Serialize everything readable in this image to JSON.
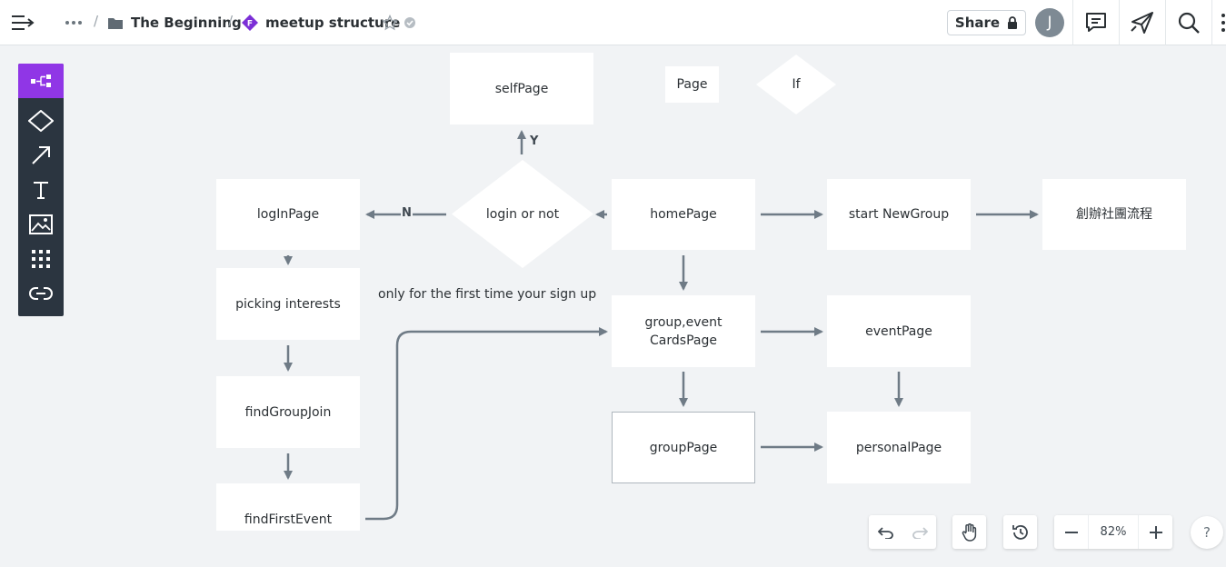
{
  "breadcrumb": {
    "folder": "The Beginning",
    "separator": "/",
    "document": "meetup structure",
    "doc_badge": "F"
  },
  "header": {
    "share_label": "Share",
    "avatar_initial": "J"
  },
  "toolbar": {
    "tools": [
      "flowchart-icon",
      "diamond-shape-icon",
      "arrow-icon",
      "text-icon",
      "image-icon",
      "grid-icon",
      "link-icon"
    ]
  },
  "legend": {
    "page": "Page",
    "if": "If"
  },
  "nodes": {
    "selfPage": "selfPage",
    "logInPage": "logInPage",
    "login_or_not": "login or not",
    "homePage": "homePage",
    "startNewGroup": "start NewGroup",
    "chinese": "創辦社團流程",
    "pickingInterests": "picking interests",
    "groupEventCards_line1": "group,event",
    "groupEventCards_line2": "CardsPage",
    "eventPage": "eventPage",
    "findGroupJoin": "findGroupJoin",
    "groupPage": "groupPage",
    "personalPage": "personalPage",
    "findFirstEvent": "findFirstEvent"
  },
  "annotations": {
    "first_time_note": "only for the first time your sign up",
    "yes_label": "Y",
    "no_label": "N"
  },
  "controls": {
    "zoom": "82%",
    "help": "?"
  },
  "colors": {
    "accent": "#9036e6",
    "toolbar_bg": "#2b3540",
    "connector": "#6f7b86",
    "canvas_bg": "#f1f3f5"
  }
}
